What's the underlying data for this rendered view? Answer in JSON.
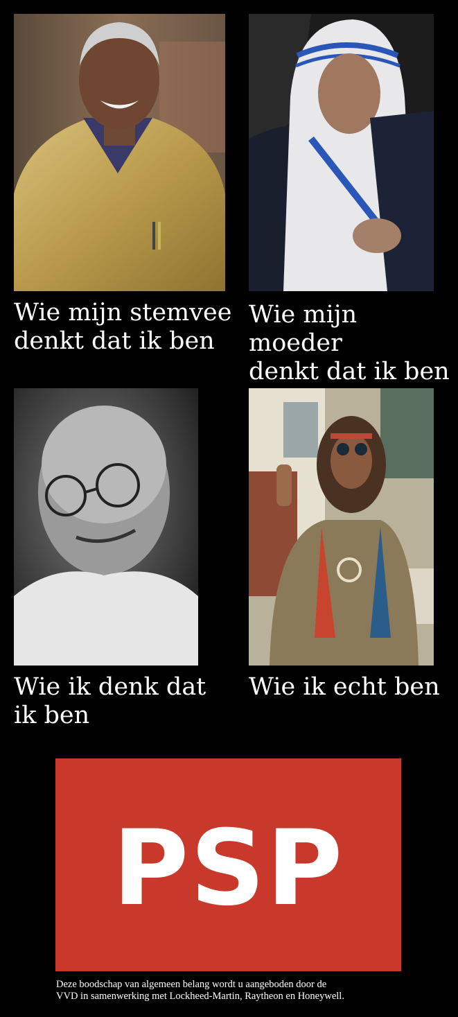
{
  "panels": [
    {
      "caption": "Wie mijn stemvee\ndenkt dat ik ben"
    },
    {
      "caption": "Wie mijn moeder\ndenkt dat ik ben"
    },
    {
      "caption": "Wie ik denk dat\nik ben"
    },
    {
      "caption": "Wie ik echt ben"
    }
  ],
  "logo": {
    "text": "PSP",
    "color": "#c8392b"
  },
  "footer": {
    "text": "Deze boodschap van algemeen belang wordt u aangeboden door de\nVVD in samenwerking met Lockheed-Martin, Raytheon en Honeywell."
  }
}
